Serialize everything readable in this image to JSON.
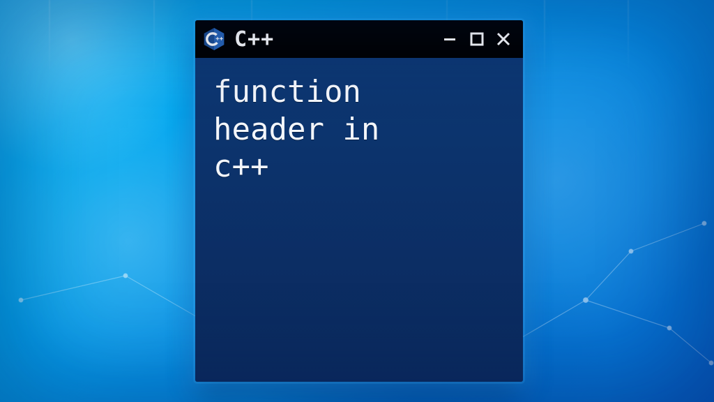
{
  "window": {
    "title": "C++",
    "controls": {
      "minimize_tooltip": "Minimize",
      "maximize_tooltip": "Maximize",
      "close_tooltip": "Close"
    }
  },
  "content": {
    "text": "function\nheader in\nc++"
  },
  "colors": {
    "titlebar_bg": "#000000",
    "content_bg": "#0f3870",
    "accent": "#19b6f3"
  }
}
